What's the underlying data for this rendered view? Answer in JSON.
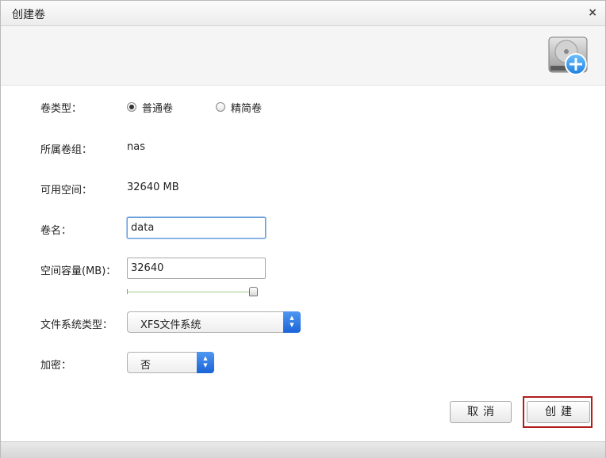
{
  "dialog": {
    "title": "创建卷",
    "close_glyph": "×"
  },
  "banner": {
    "icon": "hard-disk-add-icon"
  },
  "form": {
    "volume_type": {
      "label": "卷类型：",
      "options": [
        {
          "label": "普通卷",
          "selected": true
        },
        {
          "label": "精简卷",
          "selected": false
        }
      ]
    },
    "volume_group": {
      "label": "所属卷组：",
      "value": "nas"
    },
    "available_space": {
      "label": "可用空间：",
      "value": "32640 MB"
    },
    "volume_name": {
      "label": "卷名：",
      "value": "data"
    },
    "capacity": {
      "label": "空间容量(MB)：",
      "value": "32640",
      "slider_level": 1.0
    },
    "filesystem": {
      "label": "文件系统类型：",
      "selected": "XFS文件系统"
    },
    "encryption": {
      "label": "加密：",
      "selected": "否"
    }
  },
  "buttons": {
    "cancel": "取消",
    "create": "创建"
  },
  "colors": {
    "accent": "#1a64d8",
    "highlight": "#b01e1e"
  }
}
